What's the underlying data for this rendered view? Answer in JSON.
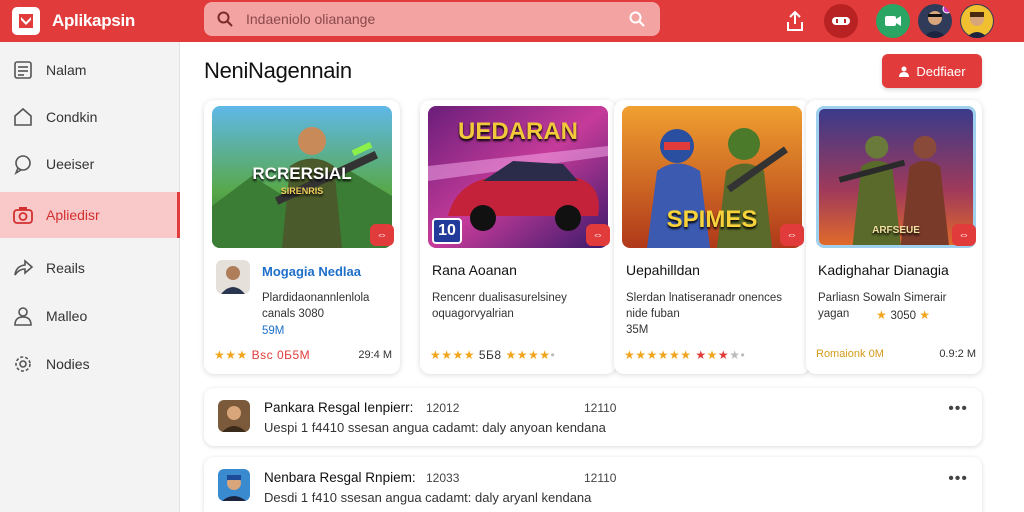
{
  "app": {
    "title": "Aplikapsin"
  },
  "search": {
    "placeholder": "Indaeniolo olianange"
  },
  "sidebar": {
    "items": [
      {
        "label": "Nalam",
        "icon": "list-icon",
        "active": false
      },
      {
        "label": "Condkin",
        "icon": "home-icon",
        "active": false
      },
      {
        "label": "Ueeiser",
        "icon": "chat-icon",
        "active": false
      },
      {
        "label": "Apliedisr",
        "icon": "camera-icon",
        "active": true
      },
      {
        "label": "Reails",
        "icon": "share-icon",
        "active": false
      },
      {
        "label": "Malleo",
        "icon": "user-icon",
        "active": false
      },
      {
        "label": "Nodies",
        "icon": "gear-icon",
        "active": false
      }
    ]
  },
  "main": {
    "title": "NeniNagennain",
    "primary_button": "Dedfiaer"
  },
  "cards": [
    {
      "art_title": "RCRERSIAL",
      "art_sub": "SIRENRIS",
      "name": "Mogagia Nedlaa",
      "desc": "Plardidaonannlenlola canals 3080",
      "extra": "59M",
      "rating_text": "Bsc 0Б5M",
      "size": "29:4 M",
      "badge": "⇔"
    },
    {
      "art_title": "UEDARAN",
      "art_sub": "",
      "corner_number": "10",
      "name": "Rana Aoanan",
      "desc": "Rencenr dualisasurelsiney oquagorvyalrian",
      "extra": "",
      "rating_text": "5Б8",
      "size": "",
      "badge": "⇔"
    },
    {
      "art_title": "SPIMES",
      "art_sub": "",
      "name": "Uepahilldan",
      "desc": "Slerdan lnatiseranadr onences nide fuban",
      "extra": "35M",
      "rating_text": "",
      "size": "",
      "badge": "⇔"
    },
    {
      "art_title": "ARFSEUE",
      "art_sub": "",
      "name": "Kadighahar Dianagia",
      "desc": "Parliasn Sowaln Simerair yagan",
      "extra": "3050",
      "rating_text": "Romaionk 0M",
      "size": "0.9:2 M",
      "badge": "⇔"
    }
  ],
  "list": [
    {
      "title": "Pankara Resgal Ienpierr:",
      "num": "12012",
      "time": "12110",
      "sub": "Uespi 1 f4410 ssesan angua cadamt: daly anyoan kendana"
    },
    {
      "title": "Nenbara Resgal Rnpiem:",
      "num": "12033",
      "time": "12110",
      "sub": "Desdi 1 f410 ssesan angua cadamt: daly aryanl kendana"
    }
  ],
  "colors": {
    "brand": "#e23b3b",
    "brand_light": "#f4a3a3",
    "star": "#f0a51c"
  }
}
